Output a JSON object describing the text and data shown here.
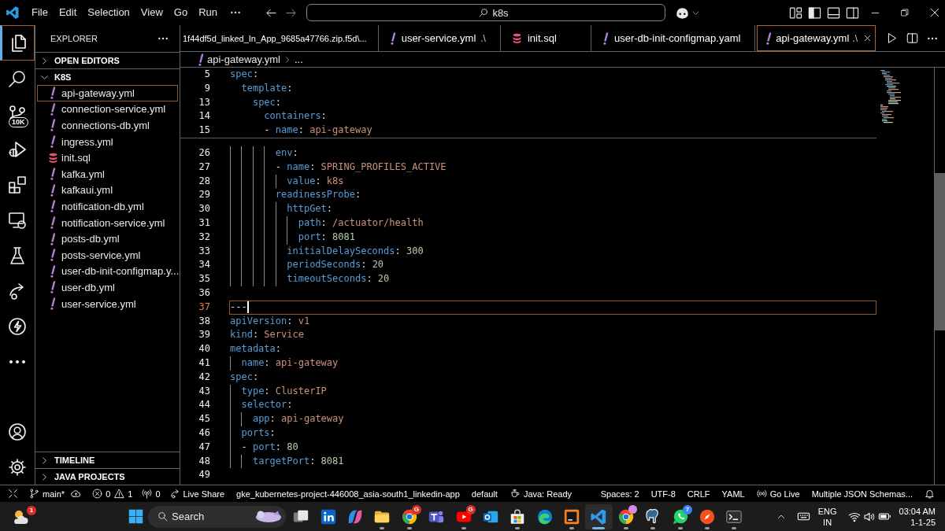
{
  "title_bar": {
    "menus": [
      "File",
      "Edit",
      "Selection",
      "View",
      "Go",
      "Run"
    ],
    "command_center": {
      "value": "k8s"
    }
  },
  "activity_bar": {
    "top": [
      {
        "kind": "explorer",
        "selected": true
      },
      {
        "kind": "search",
        "selected": false
      },
      {
        "kind": "scm",
        "selected": false,
        "badge": "10K"
      },
      {
        "kind": "debug",
        "selected": false
      },
      {
        "kind": "extensions",
        "selected": false
      },
      {
        "kind": "remote",
        "selected": false
      },
      {
        "kind": "testing",
        "selected": false
      },
      {
        "kind": "share",
        "selected": false
      },
      {
        "kind": "bolt",
        "selected": false
      },
      {
        "kind": "more",
        "selected": false
      }
    ],
    "bottom": [
      {
        "kind": "account",
        "selected": false
      },
      {
        "kind": "settings",
        "selected": false
      }
    ]
  },
  "sidebar": {
    "title": "EXPLORER",
    "sections": [
      {
        "label": "OPEN EDITORS",
        "expanded": false
      },
      {
        "label": "K8S",
        "expanded": true,
        "children": [
          {
            "label": "api-gateway.yml",
            "kind": "yaml",
            "selected": true
          },
          {
            "label": "connection-service.yml",
            "kind": "yaml",
            "selected": false
          },
          {
            "label": "connections-db.yml",
            "kind": "yaml",
            "selected": false
          },
          {
            "label": "ingress.yml",
            "kind": "yaml",
            "selected": false
          },
          {
            "label": "init.sql",
            "kind": "sql",
            "selected": false
          },
          {
            "label": "kafka.yml",
            "kind": "yaml",
            "selected": false
          },
          {
            "label": "kafkaui.yml",
            "kind": "yaml",
            "selected": false
          },
          {
            "label": "notification-db.yml",
            "kind": "yaml",
            "selected": false
          },
          {
            "label": "notification-service.yml",
            "kind": "yaml",
            "selected": false
          },
          {
            "label": "posts-db.yml",
            "kind": "yaml",
            "selected": false
          },
          {
            "label": "posts-service.yml",
            "kind": "yaml",
            "selected": false
          },
          {
            "label": "user-db-init-configmap.y...",
            "kind": "yaml",
            "selected": false
          },
          {
            "label": "user-db.yml",
            "kind": "yaml",
            "selected": false
          },
          {
            "label": "user-service.yml",
            "kind": "yaml",
            "selected": false
          }
        ]
      },
      {
        "label": "TIMELINE",
        "expanded": false
      },
      {
        "label": "JAVA PROJECTS",
        "expanded": false
      }
    ]
  },
  "tabs": [
    {
      "label": "1f44df5d_linked_In_App_9685a47766.zip.f5d\\...",
      "selected": false
    },
    {
      "label": "user-service.yml",
      "description": ".\\",
      "kind": "yaml",
      "selected": false
    },
    {
      "label": "init.sql",
      "kind": "sql",
      "selected": false
    },
    {
      "label": "user-db-init-configmap.yaml",
      "kind": "yaml",
      "selected": false
    },
    {
      "label": "api-gateway.yml",
      "description": ".\\",
      "kind": "yaml",
      "selected": true
    }
  ],
  "breadcrumb": [
    {
      "label": "api-gateway.yml",
      "kind": "yaml"
    },
    {
      "label": "..."
    }
  ],
  "editor": {
    "sticky_lines": [
      {
        "number": "5",
        "tokens": [
          {
            "kind": "key",
            "text": "spec"
          },
          {
            "kind": "punct",
            "text": ":"
          }
        ]
      },
      {
        "number": "9",
        "tokens": [
          {
            "kind": "key",
            "text": "  template"
          },
          {
            "kind": "punct",
            "text": ":"
          }
        ]
      },
      {
        "number": "13",
        "tokens": [
          {
            "kind": "key",
            "text": "    spec"
          },
          {
            "kind": "punct",
            "text": ":"
          }
        ]
      },
      {
        "number": "14",
        "tokens": [
          {
            "kind": "key",
            "text": "      containers"
          },
          {
            "kind": "punct",
            "text": ":"
          }
        ]
      },
      {
        "number": "15",
        "tokens": [
          {
            "kind": "punct",
            "text": "      - "
          },
          {
            "kind": "key",
            "text": "name"
          },
          {
            "kind": "punct",
            "text": ": "
          },
          {
            "kind": "string",
            "text": "api-gateway"
          }
        ]
      }
    ],
    "lines": [
      {
        "number": "26",
        "active": false,
        "tokens": [
          {
            "kind": "key",
            "text": "        env"
          },
          {
            "kind": "punct",
            "text": ":"
          }
        ]
      },
      {
        "number": "27",
        "active": false,
        "tokens": [
          {
            "kind": "punct",
            "text": "        - "
          },
          {
            "kind": "key",
            "text": "name"
          },
          {
            "kind": "punct",
            "text": ": "
          },
          {
            "kind": "string",
            "text": "SPRING_PROFILES_ACTIVE"
          }
        ]
      },
      {
        "number": "28",
        "active": false,
        "tokens": [
          {
            "kind": "key",
            "text": "          value"
          },
          {
            "kind": "punct",
            "text": ": "
          },
          {
            "kind": "string",
            "text": "k8s"
          }
        ]
      },
      {
        "number": "29",
        "active": false,
        "tokens": [
          {
            "kind": "key",
            "text": "        readinessProbe"
          },
          {
            "kind": "punct",
            "text": ":"
          }
        ]
      },
      {
        "number": "30",
        "active": false,
        "tokens": [
          {
            "kind": "key",
            "text": "          httpGet"
          },
          {
            "kind": "punct",
            "text": ":"
          }
        ]
      },
      {
        "number": "31",
        "active": false,
        "tokens": [
          {
            "kind": "key",
            "text": "            path"
          },
          {
            "kind": "punct",
            "text": ": "
          },
          {
            "kind": "string",
            "text": "/actuator/health"
          }
        ]
      },
      {
        "number": "32",
        "active": false,
        "tokens": [
          {
            "kind": "key",
            "text": "            port"
          },
          {
            "kind": "punct",
            "text": ": "
          },
          {
            "kind": "number",
            "text": "8081"
          }
        ]
      },
      {
        "number": "33",
        "active": false,
        "tokens": [
          {
            "kind": "key",
            "text": "          initialDelaySeconds"
          },
          {
            "kind": "punct",
            "text": ": "
          },
          {
            "kind": "number",
            "text": "300"
          }
        ]
      },
      {
        "number": "34",
        "active": false,
        "tokens": [
          {
            "kind": "key",
            "text": "          periodSeconds"
          },
          {
            "kind": "punct",
            "text": ": "
          },
          {
            "kind": "number",
            "text": "20"
          }
        ]
      },
      {
        "number": "35",
        "active": false,
        "tokens": [
          {
            "kind": "key",
            "text": "          timeoutSeconds"
          },
          {
            "kind": "punct",
            "text": ": "
          },
          {
            "kind": "number",
            "text": "20"
          }
        ]
      },
      {
        "number": "36",
        "active": false
      },
      {
        "number": "37",
        "active": true,
        "tokens": [
          {
            "kind": "punct",
            "text": "---"
          }
        ]
      },
      {
        "number": "38",
        "active": false,
        "tokens": [
          {
            "kind": "key",
            "text": "apiVersion"
          },
          {
            "kind": "punct",
            "text": ": "
          },
          {
            "kind": "string",
            "text": "v1"
          }
        ]
      },
      {
        "number": "39",
        "active": false,
        "tokens": [
          {
            "kind": "key",
            "text": "kind"
          },
          {
            "kind": "punct",
            "text": ": "
          },
          {
            "kind": "string",
            "text": "Service"
          }
        ]
      },
      {
        "number": "40",
        "active": false,
        "tokens": [
          {
            "kind": "key",
            "text": "metadata"
          },
          {
            "kind": "punct",
            "text": ":"
          }
        ]
      },
      {
        "number": "41",
        "active": false,
        "tokens": [
          {
            "kind": "key",
            "text": "  name"
          },
          {
            "kind": "punct",
            "text": ": "
          },
          {
            "kind": "string",
            "text": "api-gateway"
          }
        ]
      },
      {
        "number": "42",
        "active": false,
        "tokens": [
          {
            "kind": "key",
            "text": "spec"
          },
          {
            "kind": "punct",
            "text": ":"
          }
        ]
      },
      {
        "number": "43",
        "active": false,
        "tokens": [
          {
            "kind": "key",
            "text": "  type"
          },
          {
            "kind": "punct",
            "text": ": "
          },
          {
            "kind": "string",
            "text": "ClusterIP"
          }
        ]
      },
      {
        "number": "44",
        "active": false,
        "tokens": [
          {
            "kind": "key",
            "text": "  selector"
          },
          {
            "kind": "punct",
            "text": ":"
          }
        ]
      },
      {
        "number": "45",
        "active": false,
        "tokens": [
          {
            "kind": "key",
            "text": "    app"
          },
          {
            "kind": "punct",
            "text": ": "
          },
          {
            "kind": "string",
            "text": "api-gateway"
          }
        ]
      },
      {
        "number": "46",
        "active": false,
        "tokens": [
          {
            "kind": "key",
            "text": "  ports"
          },
          {
            "kind": "punct",
            "text": ":"
          }
        ]
      },
      {
        "number": "47",
        "active": false,
        "tokens": [
          {
            "kind": "punct",
            "text": "  - "
          },
          {
            "kind": "key",
            "text": "port"
          },
          {
            "kind": "punct",
            "text": ": "
          },
          {
            "kind": "number",
            "text": "80"
          }
        ]
      },
      {
        "number": "48",
        "active": false,
        "tokens": [
          {
            "kind": "key",
            "text": "    targetPort"
          },
          {
            "kind": "punct",
            "text": ": "
          },
          {
            "kind": "number",
            "text": "8081"
          }
        ]
      },
      {
        "number": "49",
        "active": false
      }
    ]
  },
  "status_bar": {
    "left": [
      {
        "kind": "remote"
      },
      {
        "kind": "branch",
        "text": "main*"
      },
      {
        "kind": "sync"
      },
      {
        "kind": "errors",
        "text": "0"
      },
      {
        "kind": "warnings",
        "text": "1"
      },
      {
        "kind": "ports",
        "text": "0"
      },
      {
        "kind": "share",
        "text": "Live Share"
      },
      {
        "kind": "plain",
        "text": "gke_kubernetes-project-446008_asia-south1_linkedin-app"
      },
      {
        "kind": "plain",
        "text": "default"
      },
      {
        "kind": "java",
        "text": "Java: Ready"
      }
    ],
    "right": [
      {
        "kind": "plain",
        "text": "Spaces: 2"
      },
      {
        "kind": "plain",
        "text": "UTF-8"
      },
      {
        "kind": "plain",
        "text": "CRLF"
      },
      {
        "kind": "plain",
        "text": "YAML"
      },
      {
        "kind": "golive",
        "text": "Go Live"
      },
      {
        "kind": "plain",
        "text": "Multiple JSON Schemas..."
      },
      {
        "kind": "bell"
      }
    ]
  },
  "taskbar": {
    "widgets": {
      "badge": "1"
    },
    "search": {
      "placeholder": "Search"
    },
    "apps": [
      {
        "kind": "taskview",
        "selected": false,
        "running": false
      },
      {
        "kind": "linkedin",
        "selected": false,
        "running": false
      },
      {
        "kind": "copilot",
        "selected": false,
        "running": false
      },
      {
        "kind": "folder",
        "selected": false,
        "running": true
      },
      {
        "kind": "chrome",
        "selected": false,
        "running": true,
        "badge": {
          "text": "G",
          "color": "#d93025"
        }
      },
      {
        "kind": "teams",
        "selected": false,
        "running": false
      },
      {
        "kind": "youtube",
        "selected": false,
        "running": true,
        "badge": {
          "text": "G",
          "color": "#d93025"
        }
      },
      {
        "kind": "outlook",
        "selected": false,
        "running": false
      },
      {
        "kind": "store",
        "selected": false,
        "running": true
      },
      {
        "kind": "edge",
        "selected": false,
        "running": false
      },
      {
        "kind": "ide",
        "selected": false,
        "running": true
      },
      {
        "kind": "vscode",
        "selected": true,
        "running": true
      },
      {
        "kind": "chrome",
        "selected": false,
        "running": true,
        "avatar": true
      },
      {
        "kind": "elephant",
        "selected": false,
        "running": true
      },
      {
        "kind": "whatsapp",
        "selected": false,
        "running": true,
        "badge": {
          "text": "7",
          "color": "#3b82f6"
        }
      },
      {
        "kind": "compass",
        "selected": false,
        "running": true
      },
      {
        "kind": "terminal",
        "selected": false,
        "running": true
      }
    ],
    "tray": {
      "language": "ENG",
      "region": "IN",
      "time": "03:04 AM",
      "date": "1-1-25"
    }
  }
}
